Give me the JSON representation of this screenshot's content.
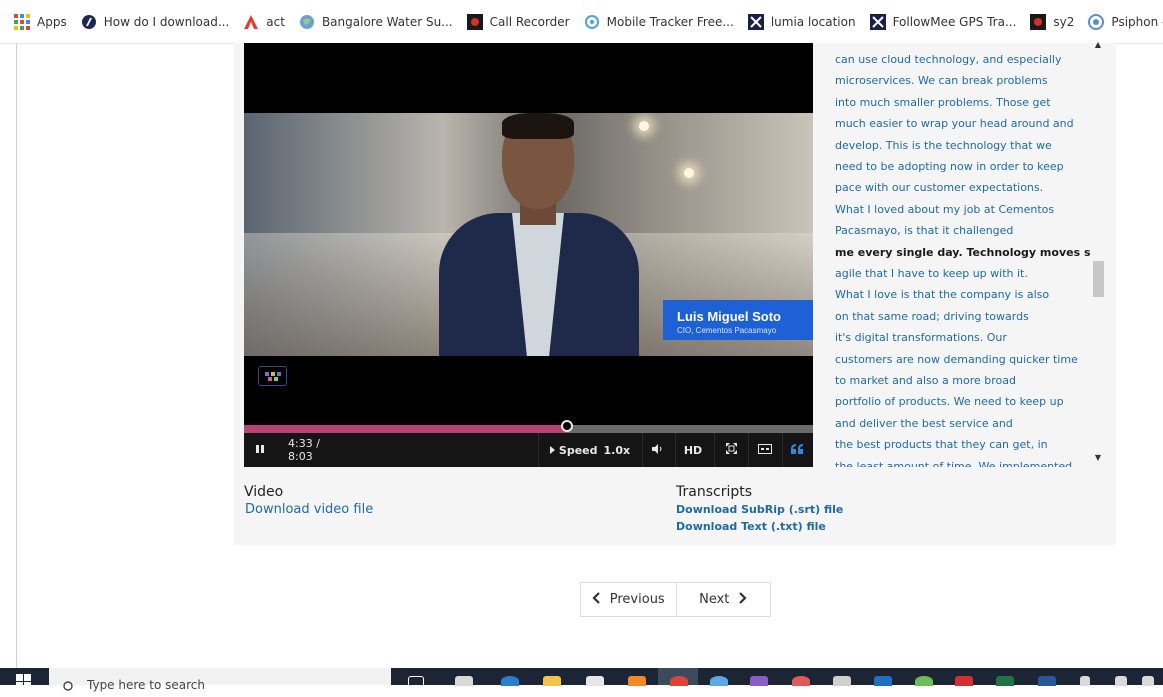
{
  "bookmarks": [
    {
      "label": "Apps",
      "icon": "apps-grid-icon"
    },
    {
      "label": "How do I download...",
      "icon": "cortana-icon"
    },
    {
      "label": "act",
      "icon": "act-logo-icon"
    },
    {
      "label": "Bangalore Water Su...",
      "icon": "globe-icon"
    },
    {
      "label": "Call Recorder",
      "icon": "call-recorder-icon"
    },
    {
      "label": "Mobile Tracker Free...",
      "icon": "mobile-tracker-icon"
    },
    {
      "label": "lumia location",
      "icon": "lumia-icon"
    },
    {
      "label": "FollowMee GPS Tra...",
      "icon": "followmee-icon"
    },
    {
      "label": "sy2",
      "icon": "sy2-icon"
    },
    {
      "label": "Psiphon - Downloa",
      "icon": "psiphon-icon"
    }
  ],
  "video": {
    "overlay_name": "Luis Miguel Soto",
    "overlay_title": "CIO, Cementos Pacasmayo",
    "progress_fraction": 0.568,
    "time": "4:33 / 8:03",
    "speed_label": "Speed",
    "speed_value": "1.0x",
    "hd_label": "HD"
  },
  "transcript": {
    "lines": [
      "can use cloud technology, and especially",
      "microservices. We can break problems",
      "into much smaller problems. Those get",
      "much easier to wrap your head around and",
      "develop. This is the technology that we",
      "need to be adopting now in order to keep",
      "pace with our customer expectations.",
      "What I loved about my job at Cementos",
      "Pacasmayo, is that it challenged",
      "me every single day. Technology moves so",
      "agile that I have to keep up with it.",
      "What I love is that the company is also",
      "on that same road; driving towards",
      "it's digital transformations. Our",
      "customers are now demanding quicker time",
      "to market and also a more broad",
      "portfolio of products. We need to keep up",
      "and deliver the best service and",
      "the best products that they can get, in",
      "the least amount of time. We implemented"
    ],
    "active_index": 9
  },
  "downloads": {
    "video_heading": "Video",
    "video_link": "Download video file",
    "transcripts_heading": "Transcripts",
    "srt_link": "Download SubRip (.srt) file",
    "txt_link": "Download Text (.txt) file"
  },
  "pagination": {
    "previous": "Previous",
    "next": "Next"
  },
  "taskbar": {
    "search_placeholder": "Type here to search"
  },
  "colors": {
    "link": "#1f6aa5",
    "progress": "#b94375",
    "overlay_blue": "#1e60d6"
  }
}
